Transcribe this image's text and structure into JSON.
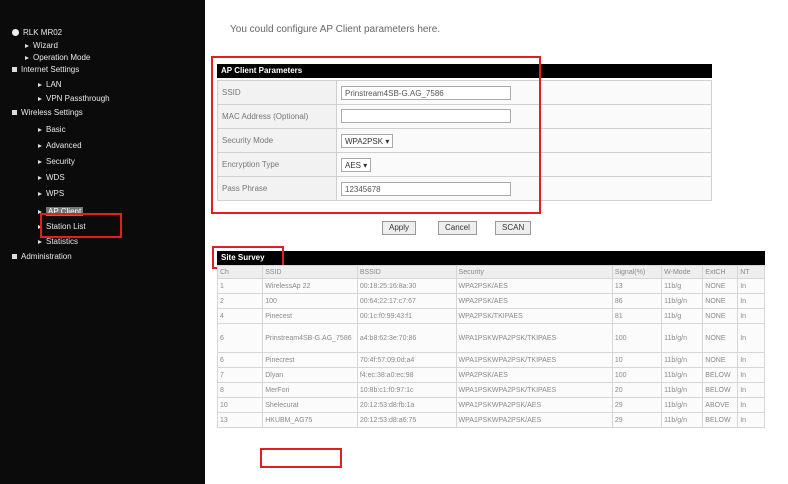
{
  "sidebar": {
    "root": "RLK MR02",
    "items": [
      {
        "label": "Wizard"
      },
      {
        "label": "Operation Mode"
      },
      {
        "label": "Internet Settings"
      },
      {
        "label": "LAN"
      },
      {
        "label": "VPN Passthrough"
      },
      {
        "label": "Wireless Settings"
      },
      {
        "label": "Basic"
      },
      {
        "label": "Advanced"
      },
      {
        "label": "Security"
      },
      {
        "label": "WDS"
      },
      {
        "label": "WPS"
      },
      {
        "label": "AP Client"
      },
      {
        "label": "Station List"
      },
      {
        "label": "Statistics"
      },
      {
        "label": "Administration"
      }
    ]
  },
  "intro": "You could configure AP Client parameters here.",
  "ap_client": {
    "title": "AP Client Parameters",
    "ssid_label": "SSID",
    "ssid_value": "Prinstream4SB-G.AG_7586",
    "mac_label": "MAC Address (Optional)",
    "mac_value": "",
    "security_label": "Security Mode",
    "security_value": "WPA2PSK",
    "encryption_label": "Encryption Type",
    "encryption_value": "AES",
    "pass_label": "Pass Phrase",
    "pass_value": "12345678"
  },
  "buttons": {
    "apply": "Apply",
    "cancel": "Cancel",
    "scan": "SCAN"
  },
  "survey": {
    "title": "Site Survey",
    "headers": [
      "Ch",
      "SSID",
      "BSSID",
      "Security",
      "Signal(%)",
      "W-Mode",
      "ExtCH",
      "NT"
    ],
    "rows": [
      [
        "1",
        "WirelessAp 22",
        "00:18:25:16:8a:30",
        "WPA2PSK/AES",
        "13",
        "11b/g",
        "NONE",
        "In"
      ],
      [
        "2",
        "100",
        "00:64:22:17:c7:67",
        "WPA2PSK/AES",
        "86",
        "11b/g/n",
        "NONE",
        "In"
      ],
      [
        "4",
        "Pinecest",
        "00:1c:f0:99:43:f1",
        "WPA2PSK/TKIPAES",
        "81",
        "11b/g",
        "NONE",
        "In"
      ],
      [
        "6",
        "Prinstream4SB-G.AG_7586",
        "a4:b8:62:3e:70:86",
        "WPA1PSKWPA2PSK/TKIPAES",
        "100",
        "11b/g/n",
        "NONE",
        "In"
      ],
      [
        "6",
        "Pinecrest",
        "70:4f:57:09:0d:a4",
        "WPA1PSKWPA2PSK/TKIPAES",
        "10",
        "11b/g/n",
        "NONE",
        "In"
      ],
      [
        "7",
        "Dlyan",
        "f4:ec:38:a0:ec:98",
        "WPA2PSK/AES",
        "100",
        "11b/g/n",
        "BELOW",
        "In"
      ],
      [
        "8",
        "MerFori",
        "10:8b:c1:f0:97:1c",
        "WPA1PSKWPA2PSK/TKIPAES",
        "20",
        "11b/g/n",
        "BELOW",
        "In"
      ],
      [
        "10",
        "Shelecurat",
        "20:12:53:d8:fb:1a",
        "WPA1PSKWPA2PSK/AES",
        "29",
        "11b/g/n",
        "ABOVE",
        "In"
      ],
      [
        "13",
        "HKUBM_AG75",
        "20:12:53:d8:a6:75",
        "WPA1PSKWPA2PSK/AES",
        "29",
        "11b/g/n",
        "BELOW",
        "In"
      ]
    ]
  },
  "colors": {
    "highlight": "#e02020",
    "sidebar_bg": "#0b0b0b",
    "header_bg": "#000000"
  }
}
